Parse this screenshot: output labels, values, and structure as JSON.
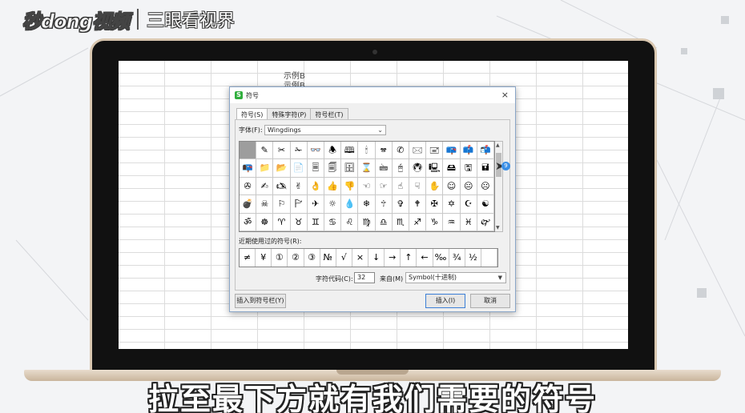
{
  "watermark": {
    "logo": "秒dong视频",
    "brand": "三眼看视界"
  },
  "sheet": {
    "cells": [
      "示例B",
      "示例B"
    ]
  },
  "dialog": {
    "title": "符号",
    "app_icon": "S",
    "tabs": [
      {
        "label": "符号(S)",
        "active": true
      },
      {
        "label": "特殊字符(P)",
        "active": false
      },
      {
        "label": "符号栏(T)",
        "active": false
      }
    ],
    "font_label": "字体(F):",
    "font_value": "Wingdings",
    "symbols": [
      "",
      "✎",
      "✂",
      "✁",
      "👓",
      "🕭",
      "🕮",
      "🕯",
      "🕿",
      "✆",
      "🖂",
      "🖃",
      "📪",
      "📫",
      "📬",
      "📭",
      "📁",
      "📂",
      "📄",
      "🗏",
      "🗐",
      "🗄",
      "⌛",
      "🖮",
      "🖰",
      "🖲",
      "🖳",
      "🖴",
      "🖫",
      "🖬",
      "✇",
      "✍",
      "🖎",
      "✌",
      "👌",
      "👍",
      "👎",
      "☜",
      "☞",
      "☝",
      "☟",
      "✋",
      "☺",
      "😐",
      "☹",
      "💣",
      "☠",
      "⚐",
      "🏱",
      "✈",
      "☼",
      "💧",
      "❄",
      "🕆",
      "✞",
      "🕈",
      "✠",
      "✡",
      "☪",
      "☯",
      "ॐ",
      "☸",
      "♈",
      "♉",
      "♊",
      "♋",
      "♌",
      "♍",
      "♎",
      "♏",
      "♐",
      "♑",
      "♒",
      "♓",
      "🙰",
      "🙵",
      "●",
      "❍",
      "■",
      "□",
      "◻",
      "❑",
      "❒",
      "⬧",
      "⧫",
      "◆",
      "❖",
      "⬥",
      "⌧",
      "⍓"
    ],
    "selected_index": 0,
    "recent_label": "近期使用过的符号(R):",
    "recent": [
      "≠",
      "¥",
      "①",
      "②",
      "③",
      "№",
      "√",
      "×",
      "↓",
      "→",
      "↑",
      "←",
      "‰",
      "¾",
      "½",
      ""
    ],
    "scroll_badge": "9",
    "code_label": "字符代码(C):",
    "code_value": "32",
    "from_label": "来自(M)",
    "from_value": "Symbol(十进制)",
    "insert_to_bar": "插入到符号栏(Y)",
    "insert": "插入(I)",
    "cancel": "取消",
    "close": "×"
  },
  "caption": "拉至最下方就有我们需要的符号"
}
